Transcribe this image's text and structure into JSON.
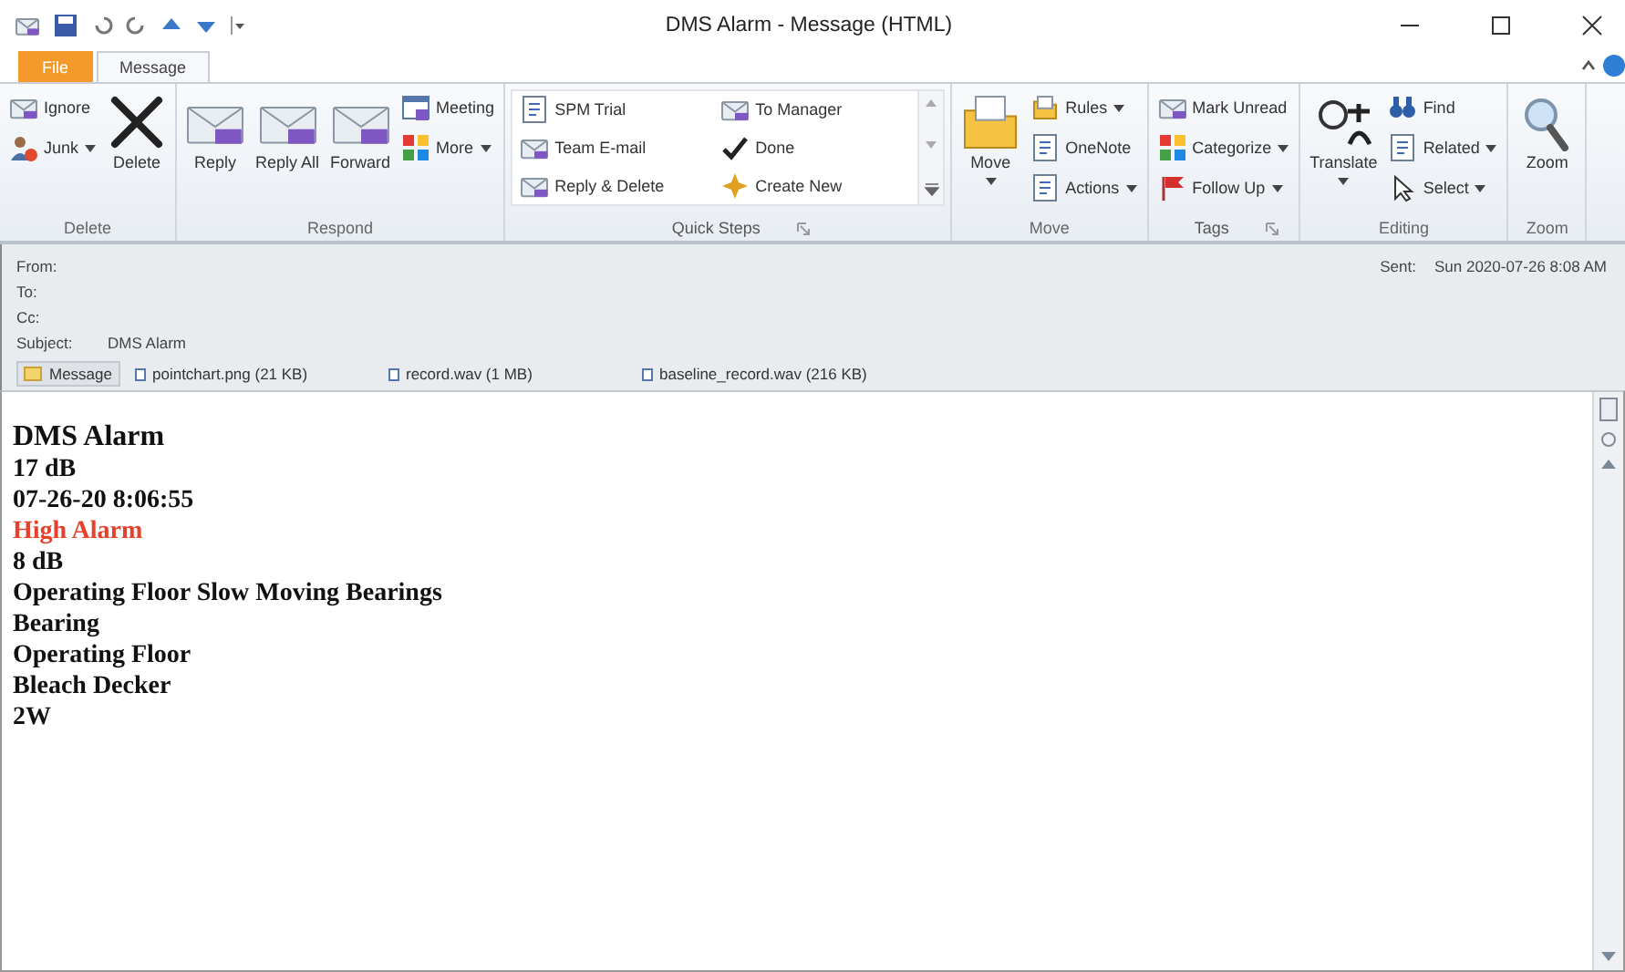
{
  "window": {
    "title": "DMS Alarm - Message (HTML)"
  },
  "tabs": [
    {
      "label": "File",
      "selected": false,
      "kind": "file"
    },
    {
      "label": "Message",
      "selected": true,
      "kind": "tab"
    }
  ],
  "ribbon": {
    "groups": [
      {
        "label": "Delete",
        "launcher": false,
        "items": [
          {
            "label": "Ignore",
            "kind": "small",
            "dropdown": false
          },
          {
            "label": "Junk",
            "kind": "small",
            "dropdown": true
          },
          {
            "label": "Delete",
            "kind": "large",
            "dropdown": false
          }
        ]
      },
      {
        "label": "Respond",
        "launcher": false,
        "items": [
          {
            "label": "Reply",
            "kind": "large",
            "dropdown": false
          },
          {
            "label": "Reply All",
            "kind": "large",
            "dropdown": false
          },
          {
            "label": "Forward",
            "kind": "large",
            "dropdown": false
          },
          {
            "label": "Meeting",
            "kind": "small",
            "dropdown": false
          },
          {
            "label": "More",
            "kind": "small",
            "dropdown": true
          }
        ]
      },
      {
        "label": "Quick Steps",
        "launcher": true,
        "items": [
          {
            "label": "SPM Trial",
            "kind": "gallery",
            "dropdown": false
          },
          {
            "label": "Team E-mail",
            "kind": "gallery",
            "dropdown": false
          },
          {
            "label": "Reply & Delete",
            "kind": "gallery",
            "dropdown": false
          },
          {
            "label": "To Manager",
            "kind": "gallery",
            "dropdown": false
          },
          {
            "label": "Done",
            "kind": "gallery",
            "dropdown": false
          },
          {
            "label": "Create New",
            "kind": "gallery",
            "dropdown": false
          }
        ]
      },
      {
        "label": "Move",
        "launcher": false,
        "items": [
          {
            "label": "Move",
            "kind": "large",
            "dropdown": true
          },
          {
            "label": "Rules",
            "kind": "small",
            "dropdown": true
          },
          {
            "label": "OneNote",
            "kind": "small",
            "dropdown": false
          },
          {
            "label": "Actions",
            "kind": "small",
            "dropdown": true
          }
        ]
      },
      {
        "label": "Tags",
        "launcher": true,
        "items": [
          {
            "label": "Mark Unread",
            "kind": "small",
            "dropdown": false
          },
          {
            "label": "Categorize",
            "kind": "small",
            "dropdown": true
          },
          {
            "label": "Follow Up",
            "kind": "small",
            "dropdown": true
          }
        ]
      },
      {
        "label": "Editing",
        "launcher": false,
        "items": [
          {
            "label": "Translate",
            "kind": "large",
            "dropdown": true
          },
          {
            "label": "Find",
            "kind": "small",
            "dropdown": false
          },
          {
            "label": "Related",
            "kind": "small",
            "dropdown": true
          },
          {
            "label": "Select",
            "kind": "small",
            "dropdown": true
          }
        ]
      },
      {
        "label": "Zoom",
        "launcher": false,
        "items": [
          {
            "label": "Zoom",
            "kind": "large",
            "dropdown": false
          }
        ]
      }
    ]
  },
  "header": {
    "fields": [
      {
        "label": "From:"
      },
      {
        "label": "To:"
      },
      {
        "label": "Cc:"
      },
      {
        "label": "Subject:",
        "value": "DMS Alarm"
      }
    ],
    "sent": {
      "label": "Sent:",
      "value": "Sun 2020-07-26 8:08 AM"
    }
  },
  "attachments": [
    {
      "label": "Message",
      "selected": true,
      "kind": "message"
    },
    {
      "label": "pointchart.png (21 KB)",
      "selected": false,
      "kind": "file"
    },
    {
      "label": "record.wav (1 MB)",
      "selected": false,
      "kind": "file"
    },
    {
      "label": "baseline_record.wav (216 KB)",
      "selected": false,
      "kind": "file"
    }
  ],
  "body": [
    {
      "text": "DMS Alarm",
      "kind": "title"
    },
    {
      "text": "17 dB",
      "kind": "line"
    },
    {
      "text": "07-26-20 8:06:55",
      "kind": "line"
    },
    {
      "text": "High Alarm",
      "kind": "alert"
    },
    {
      "text": "8 dB",
      "kind": "line"
    },
    {
      "text": "Operating Floor Slow Moving Bearings",
      "kind": "line"
    },
    {
      "text": "Bearing",
      "kind": "line"
    },
    {
      "text": "Operating Floor",
      "kind": "line"
    },
    {
      "text": "Bleach Decker",
      "kind": "line"
    },
    {
      "text": "2W",
      "kind": "line"
    }
  ]
}
